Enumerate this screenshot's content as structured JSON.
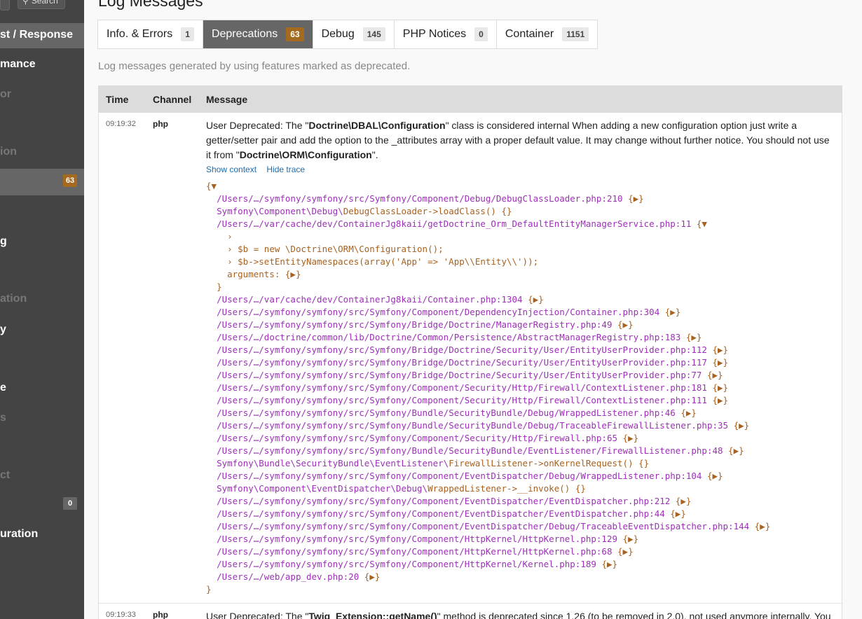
{
  "sidebar": {
    "search_label": "Search",
    "items": [
      {
        "label": "st / Response",
        "state": "active",
        "badge": ""
      },
      {
        "label": "mance",
        "state": "bright",
        "badge": ""
      },
      {
        "label": "or",
        "state": "dim",
        "badge": ""
      },
      {
        "label": "ion",
        "state": "dim",
        "badge": ""
      },
      {
        "label": "",
        "state": "active",
        "badge": "63"
      },
      {
        "label": "g",
        "state": "bright",
        "badge": ""
      },
      {
        "label": "ation",
        "state": "dim",
        "badge": ""
      },
      {
        "label": "y",
        "state": "bright",
        "badge": ""
      },
      {
        "label": "e",
        "state": "bright",
        "badge": ""
      },
      {
        "label": "s",
        "state": "dim",
        "badge": ""
      },
      {
        "label": "ct",
        "state": "dim",
        "badge": ""
      },
      {
        "label": "",
        "state": "plain",
        "badge": "0"
      },
      {
        "label": "uration",
        "state": "bright",
        "badge": ""
      }
    ]
  },
  "page": {
    "title": "Log Messages",
    "help": "Log messages generated by using features marked as deprecated."
  },
  "tabs": [
    {
      "label": "Info. & Errors",
      "count": "1",
      "active": false
    },
    {
      "label": "Deprecations",
      "count": "63",
      "active": true
    },
    {
      "label": "Debug",
      "count": "145",
      "active": false
    },
    {
      "label": "PHP Notices",
      "count": "0",
      "active": false
    },
    {
      "label": "Container",
      "count": "1151",
      "active": false
    }
  ],
  "table": {
    "headers": {
      "time": "Time",
      "channel": "Channel",
      "message": "Message"
    },
    "rows": [
      {
        "time": "09:19:32",
        "channel": "php",
        "message_parts": [
          "User Deprecated: The \"",
          "Doctrine\\DBAL\\Configuration",
          "\" class is considered internal When adding a new configuration option just write a getter/setter pair and add the option to the _attributes array with a proper default value. It may change without further notice. You should not use it from \"",
          "Doctrine\\ORM\\Configuration",
          "\"."
        ],
        "show_context": "Show context",
        "hide_trace": "Hide trace",
        "trace_open": "{▼",
        "trace_close": "}",
        "trace": [
          {
            "indent": 1,
            "text": "/Users/…/symfony/symfony/src/Symfony/Component/Debug/DebugClassLoader.php:210",
            "suffix": " {▶}",
            "kind": "file"
          },
          {
            "indent": 1,
            "ns": "Symfony\\Component\\Debug\\",
            "text": "DebugClassLoader->loadClass()",
            "suffix": " {}",
            "kind": "call"
          },
          {
            "indent": 1,
            "text": "/Users/…/var/cache/dev/ContainerJg8kaii/getDoctrine_Orm_DefaultEntityManagerService.php:11",
            "suffix": " {▼",
            "kind": "file"
          },
          {
            "indent": 2,
            "text": "›",
            "suffix": "",
            "kind": "plain"
          },
          {
            "indent": 2,
            "text": "› $b = new \\Doctrine\\ORM\\Configuration();",
            "suffix": "",
            "kind": "plain"
          },
          {
            "indent": 2,
            "text": "› $b->setEntityNamespaces(array('App' => 'App\\\\Entity\\\\'));",
            "suffix": "",
            "kind": "plain"
          },
          {
            "indent": 2,
            "text": "arguments: {▶}",
            "suffix": "",
            "kind": "plain"
          },
          {
            "indent": 1,
            "text": "}",
            "suffix": "",
            "kind": "plain"
          },
          {
            "indent": 1,
            "text": "/Users/…/var/cache/dev/ContainerJg8kaii/Container.php:1304",
            "suffix": " {▶}",
            "kind": "file"
          },
          {
            "indent": 1,
            "text": "/Users/…/symfony/symfony/src/Symfony/Component/DependencyInjection/Container.php:304",
            "suffix": " {▶}",
            "kind": "file"
          },
          {
            "indent": 1,
            "text": "/Users/…/symfony/symfony/src/Symfony/Bridge/Doctrine/ManagerRegistry.php:49",
            "suffix": " {▶}",
            "kind": "file"
          },
          {
            "indent": 1,
            "text": "/Users/…/doctrine/common/lib/Doctrine/Common/Persistence/AbstractManagerRegistry.php:183",
            "suffix": " {▶}",
            "kind": "file"
          },
          {
            "indent": 1,
            "text": "/Users/…/symfony/symfony/src/Symfony/Bridge/Doctrine/Security/User/EntityUserProvider.php:112",
            "suffix": " {▶}",
            "kind": "file"
          },
          {
            "indent": 1,
            "text": "/Users/…/symfony/symfony/src/Symfony/Bridge/Doctrine/Security/User/EntityUserProvider.php:117",
            "suffix": " {▶}",
            "kind": "file"
          },
          {
            "indent": 1,
            "text": "/Users/…/symfony/symfony/src/Symfony/Bridge/Doctrine/Security/User/EntityUserProvider.php:77",
            "suffix": " {▶}",
            "kind": "file"
          },
          {
            "indent": 1,
            "text": "/Users/…/symfony/symfony/src/Symfony/Component/Security/Http/Firewall/ContextListener.php:181",
            "suffix": " {▶}",
            "kind": "file"
          },
          {
            "indent": 1,
            "text": "/Users/…/symfony/symfony/src/Symfony/Component/Security/Http/Firewall/ContextListener.php:111",
            "suffix": " {▶}",
            "kind": "file"
          },
          {
            "indent": 1,
            "text": "/Users/…/symfony/symfony/src/Symfony/Bundle/SecurityBundle/Debug/WrappedListener.php:46",
            "suffix": " {▶}",
            "kind": "file"
          },
          {
            "indent": 1,
            "text": "/Users/…/symfony/symfony/src/Symfony/Bundle/SecurityBundle/Debug/TraceableFirewallListener.php:35",
            "suffix": " {▶}",
            "kind": "file"
          },
          {
            "indent": 1,
            "text": "/Users/…/symfony/symfony/src/Symfony/Component/Security/Http/Firewall.php:65",
            "suffix": " {▶}",
            "kind": "file"
          },
          {
            "indent": 1,
            "text": "/Users/…/symfony/symfony/src/Symfony/Bundle/SecurityBundle/EventListener/FirewallListener.php:48",
            "suffix": " {▶}",
            "kind": "file"
          },
          {
            "indent": 1,
            "ns": "Symfony\\Bundle\\SecurityBundle\\EventListener\\",
            "text": "FirewallListener->onKernelRequest()",
            "suffix": " {}",
            "kind": "call"
          },
          {
            "indent": 1,
            "text": "/Users/…/symfony/symfony/src/Symfony/Component/EventDispatcher/Debug/WrappedListener.php:104",
            "suffix": " {▶}",
            "kind": "file"
          },
          {
            "indent": 1,
            "ns": "Symfony\\Component\\EventDispatcher\\Debug\\",
            "text": "WrappedListener->__invoke()",
            "suffix": " {}",
            "kind": "call"
          },
          {
            "indent": 1,
            "text": "/Users/…/symfony/symfony/src/Symfony/Component/EventDispatcher/EventDispatcher.php:212",
            "suffix": " {▶}",
            "kind": "file"
          },
          {
            "indent": 1,
            "text": "/Users/…/symfony/symfony/src/Symfony/Component/EventDispatcher/EventDispatcher.php:44",
            "suffix": " {▶}",
            "kind": "file"
          },
          {
            "indent": 1,
            "text": "/Users/…/symfony/symfony/src/Symfony/Component/EventDispatcher/Debug/TraceableEventDispatcher.php:144",
            "suffix": " {▶}",
            "kind": "file"
          },
          {
            "indent": 1,
            "text": "/Users/…/symfony/symfony/src/Symfony/Component/HttpKernel/HttpKernel.php:129",
            "suffix": " {▶}",
            "kind": "file"
          },
          {
            "indent": 1,
            "text": "/Users/…/symfony/symfony/src/Symfony/Component/HttpKernel/HttpKernel.php:68",
            "suffix": " {▶}",
            "kind": "file"
          },
          {
            "indent": 1,
            "text": "/Users/…/symfony/symfony/src/Symfony/Component/HttpKernel/Kernel.php:189",
            "suffix": " {▶}",
            "kind": "file"
          },
          {
            "indent": 1,
            "text": "/Users/…/web/app_dev.php:20",
            "suffix": " {▶}",
            "kind": "file"
          }
        ]
      },
      {
        "time": "09:19:33",
        "channel": "php",
        "message_parts": [
          "User Deprecated: The \"",
          "Twig_Extension::getName()",
          "\" method is deprecated since 1.26 (to be removed in 2.0), not used anymore internally. You"
        ]
      }
    ]
  },
  "colors": {
    "sidebar_bg": "#444444",
    "badge_orange": "#a46a1f",
    "trace_orange": "#a8611f",
    "trace_purple": "#9d2fb9",
    "link_blue": "#1b6cad"
  }
}
